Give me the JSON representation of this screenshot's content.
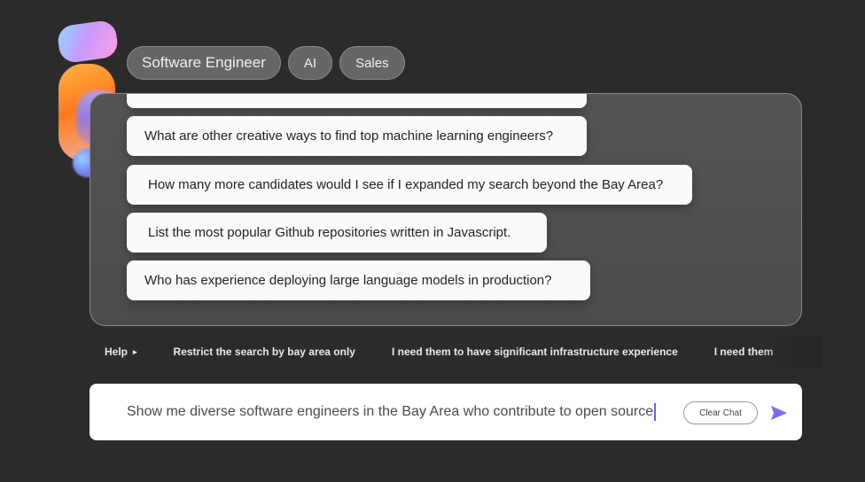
{
  "chips": [
    {
      "label": "Software Engineer"
    },
    {
      "label": "AI"
    },
    {
      "label": "Sales"
    }
  ],
  "prompts": [
    {
      "text": ""
    },
    {
      "text": "What are other creative ways to find top machine learning engineers?"
    },
    {
      "text": "How many more candidates would I see if I expanded my search beyond the Bay Area?"
    },
    {
      "text": "List the most popular Github repositories written in Javascript."
    },
    {
      "text": "Who has experience deploying large language models in production?"
    }
  ],
  "suggestions": {
    "help_label": "Help",
    "help_arrow": "▸",
    "items": [
      "Restrict the search by bay area only",
      "I need them to have significant infrastructure experience",
      "I need them"
    ]
  },
  "input": {
    "value": "Show me diverse software engineers in the Bay Area who contribute to open source",
    "clear_label": "Clear Chat",
    "send_icon": "send-icon",
    "accent_color": "#7b6cf6"
  }
}
